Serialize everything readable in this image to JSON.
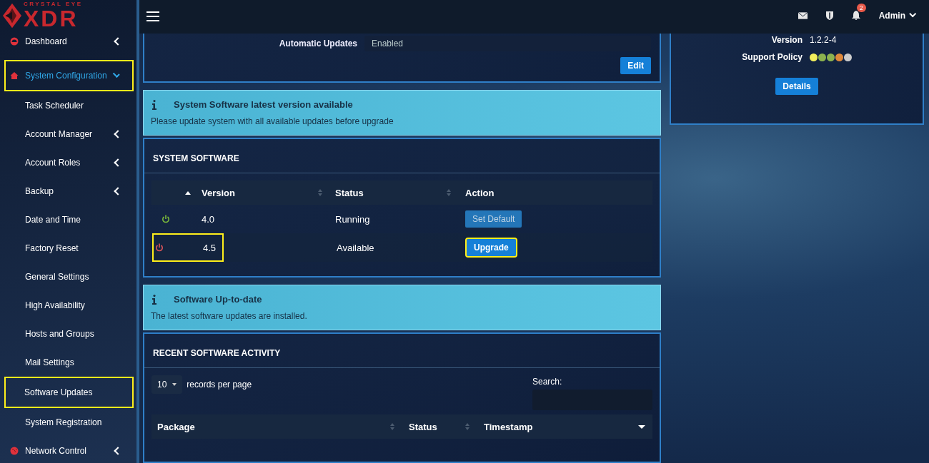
{
  "brand": {
    "top": "CRYSTAL EYE",
    "main": "XDR"
  },
  "sidebar": {
    "items": [
      {
        "label": "Dashboard",
        "kind": "submenu",
        "expanded": false,
        "selected": false,
        "highlighted": false
      },
      {
        "label": "System Configuration",
        "kind": "submenu",
        "expanded": true,
        "selected": true,
        "highlighted": true,
        "children": [
          {
            "label": "Task Scheduler",
            "kind": "link",
            "selected": false,
            "highlighted": false
          },
          {
            "label": "Account Manager",
            "kind": "submenu",
            "expanded": false,
            "selected": false,
            "highlighted": false
          },
          {
            "label": "Account Roles",
            "kind": "submenu",
            "expanded": false,
            "selected": false,
            "highlighted": false
          },
          {
            "label": "Backup",
            "kind": "submenu",
            "expanded": false,
            "selected": false,
            "highlighted": false
          },
          {
            "label": "Date and Time",
            "kind": "link",
            "selected": false,
            "highlighted": false
          },
          {
            "label": "Factory Reset",
            "kind": "link",
            "selected": false,
            "highlighted": false
          },
          {
            "label": "General Settings",
            "kind": "link",
            "selected": false,
            "highlighted": false
          },
          {
            "label": "High Availability",
            "kind": "link",
            "selected": false,
            "highlighted": false
          },
          {
            "label": "Hosts and Groups",
            "kind": "link",
            "selected": false,
            "highlighted": false
          },
          {
            "label": "Mail Settings",
            "kind": "link",
            "selected": false,
            "highlighted": false
          },
          {
            "label": "Software Updates",
            "kind": "link",
            "selected": true,
            "highlighted": true
          },
          {
            "label": "System Registration",
            "kind": "link",
            "selected": false,
            "highlighted": false
          }
        ]
      },
      {
        "label": "Network Control",
        "kind": "submenu",
        "expanded": false,
        "selected": false,
        "highlighted": false
      }
    ]
  },
  "topbar": {
    "notification_count": "2",
    "user": "Admin"
  },
  "settings_card": {
    "field_label": "Automatic Updates",
    "field_value": "Enabled",
    "button": "Edit"
  },
  "alerts": [
    {
      "title": "System Software latest version available",
      "text": "Please update system with all available updates before upgrade"
    },
    {
      "title": "Software Up-to-date",
      "text": "The latest software updates are installed."
    }
  ],
  "system_software": {
    "title": "SYSTEM SOFTWARE",
    "columns": [
      "Version",
      "Status",
      "Action"
    ],
    "rows": [
      {
        "active": true,
        "version": "4.0",
        "status": "Running",
        "highlighted": false,
        "action": {
          "label": "Set Default",
          "disabled": true,
          "highlighted": false
        }
      },
      {
        "active": false,
        "version": "4.5",
        "status": "Available",
        "highlighted": true,
        "action": {
          "label": "Upgrade",
          "disabled": false,
          "highlighted": true
        }
      }
    ]
  },
  "recent_activity": {
    "title": "RECENT SOFTWARE ACTIVITY",
    "page_size": "10",
    "page_size_label": "records per page",
    "search_label": "Search:",
    "columns": [
      "Package",
      "Status",
      "Timestamp"
    ]
  },
  "license_card": {
    "version_label": "Version",
    "version": "1.2.2-4",
    "policy_label": "Support Policy",
    "policy_dots": [
      {
        "color": "#f2ee5c"
      },
      {
        "color": "#8db34f"
      },
      {
        "color": "#8db34f"
      },
      {
        "color": "#e0893a"
      },
      {
        "color": "#cccccc"
      }
    ],
    "button": "Details"
  }
}
